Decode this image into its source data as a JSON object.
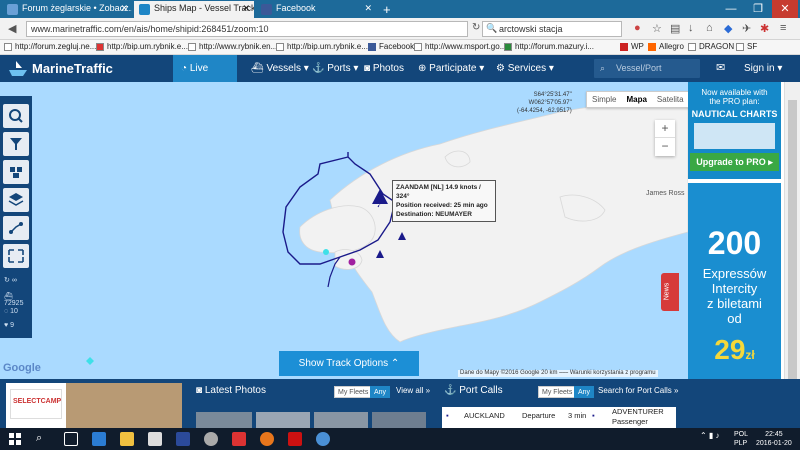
{
  "browser": {
    "tabs": [
      {
        "label": "Forum żeglarskie • Zobacz...",
        "active": false
      },
      {
        "label": "Ships Map - Vessel Tracki...",
        "active": true
      },
      {
        "label": "Facebook",
        "active": false
      }
    ],
    "new_tab": "+",
    "url": "www.marinetraffic.com/en/ais/home/shipid:268451/zoom:10",
    "search_query": "arctowski stacja",
    "window_controls": [
      "—",
      "❐",
      "✕"
    ],
    "bookmarks": [
      "http://forum.zegluj.ne...",
      "http://bip.um.rybnik.e...",
      "http://www.rybnik.en...",
      "http://bip.um.rybnik.e...",
      "Facebook",
      "http://www.msport.go...",
      "http://forum.mazury.i...",
      "WP",
      "Allegro",
      "DRAGON",
      "SF"
    ]
  },
  "site": {
    "brand": "MarineTraffic",
    "nav": [
      {
        "label": "Live Map",
        "active": true
      },
      {
        "label": "Vessels",
        "active": false
      },
      {
        "label": "Ports",
        "active": false
      },
      {
        "label": "Photos",
        "active": false
      },
      {
        "label": "Participate",
        "active": false
      },
      {
        "label": "Services",
        "active": false
      }
    ],
    "search_placeholder": "Vessel/Port",
    "signin": "Sign in"
  },
  "map": {
    "types": [
      "Simple",
      "Mapa",
      "Satelita"
    ],
    "selected_type": "Mapa",
    "coords": [
      "S64°25'31.47\"",
      "W062°57'05.97\"",
      "(-64.4254, -62.9517)"
    ],
    "zoom_in": "+",
    "zoom_out": "−",
    "place_label": "James Ross",
    "tooltip": {
      "line1": "ZAANDAM [NL] 14.9 knots / 324°",
      "line2": "Position received: 25 min ago",
      "line3": "Destination: NEUMAYER"
    },
    "left_stats": [
      "∞",
      "72925",
      "10",
      "9"
    ],
    "show_track": "Show Track Options",
    "news": "News",
    "google": "Google",
    "attribution": "Dane do Mapy ©2016 Google   20 km ⎯⎯⎯   Warunki korzystania z programu"
  },
  "ads": {
    "pro": {
      "line1": "Now available with",
      "line2": "the PRO plan:",
      "title": "NAUTICAL CHARTS",
      "cta": "Upgrade to PRO"
    },
    "express": {
      "big": "200",
      "line1": "Expressów",
      "line2": "Intercity",
      "line3": "z biletami",
      "line4": "od",
      "price": "29",
      "unit": "zł"
    },
    "selectcamp": "SELECTCAMP"
  },
  "bottom": {
    "photos_title": "Latest Photos",
    "my_fleets": "My Fleets",
    "any": "Any",
    "view_all": "View all »",
    "portcalls_title": "Port Calls",
    "search_portcalls": "Search for Port Calls »",
    "row": {
      "port": "AUCKLAND",
      "type": "Departure",
      "time": "3 min",
      "vessel": "ADVENTURER",
      "vessel_type": "Passenger"
    }
  },
  "taskbar": {
    "lang1": "POL",
    "lang2": "PLP",
    "time": "22:45",
    "date": "2016-01-20"
  },
  "colors": {
    "nav_bg": "#13467a",
    "accent": "#1f86c6",
    "sea": "#aadaff",
    "land": "#f2f2f2",
    "track": "#1a1a8a"
  }
}
